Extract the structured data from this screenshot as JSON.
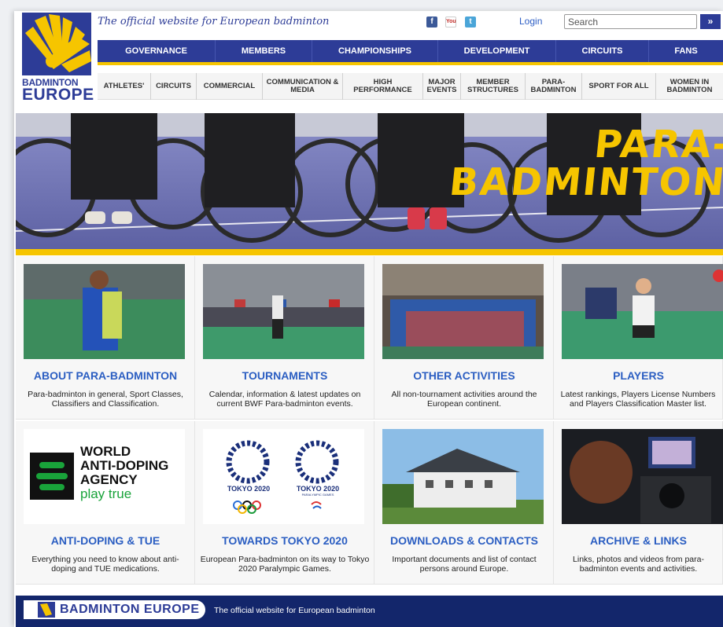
{
  "header": {
    "logo_line1": "BADMINTON",
    "logo_line2": "EUROPE",
    "tagline": "The official website for European badminton",
    "login": "Login",
    "search_placeholder": "Search",
    "search_button": "»"
  },
  "main_nav": [
    "GOVERNANCE",
    "MEMBERS",
    "CHAMPIONSHIPS",
    "DEVELOPMENT",
    "CIRCUITS",
    "FANS"
  ],
  "sub_nav": [
    "ATHLETES'",
    "CIRCUITS",
    "COMMERCIAL",
    "COMMUNICATION & MEDIA",
    "HIGH PERFORMANCE",
    "MAJOR EVENTS",
    "MEMBER STRUCTURES",
    "PARA-BADMINTON",
    "SPORT FOR ALL",
    "WOMEN IN BADMINTON"
  ],
  "hero": {
    "title_line1": "PARA-",
    "title_line2": "BADMINTON"
  },
  "cards": [
    {
      "title": "ABOUT PARA-BADMINTON",
      "desc": "Para-badminton in general, Sport Classes, Classifiers and Classification."
    },
    {
      "title": "TOURNAMENTS",
      "desc": "Calendar, information & latest updates on current BWF Para-badminton events."
    },
    {
      "title": "OTHER ACTIVITIES",
      "desc": "All non-tournament activities around the European continent."
    },
    {
      "title": "PLAYERS",
      "desc": "Latest rankings, Players License Numbers and Players Classification Master list."
    },
    {
      "title": "ANTI-DOPING & TUE",
      "desc": "Everything you need to know about anti-doping and TUE medications."
    },
    {
      "title": "TOWARDS TOKYO 2020",
      "desc": "European Para-badminton on its way to Tokyo 2020 Paralympic Games."
    },
    {
      "title": "DOWNLOADS & CONTACTS",
      "desc": "Important documents and list of contact persons around Europe."
    },
    {
      "title": "ARCHIVE & LINKS",
      "desc": "Links, photos and videos from para-badminton events and activities."
    }
  ],
  "wada": {
    "line1": "WORLD",
    "line2": "ANTI-DOPING",
    "line3": "AGENCY",
    "line4": "play true"
  },
  "tokyo": {
    "olympic": "TOKYO 2020",
    "paralympic": "TOKYO 2020",
    "paralympic_sub": "PARALYMPIC GAMES"
  },
  "footer": {
    "logo_text": "BADMINTON EUROPE",
    "tagline": "The official website for European badminton"
  },
  "colors": {
    "brand_blue": "#2d3c97",
    "brand_yellow": "#f6c500",
    "link_blue": "#2b5ec2",
    "footer_navy": "#13266b"
  },
  "icons": [
    "facebook-icon",
    "youtube-icon",
    "twitter-icon",
    "search-arrow-icon"
  ]
}
